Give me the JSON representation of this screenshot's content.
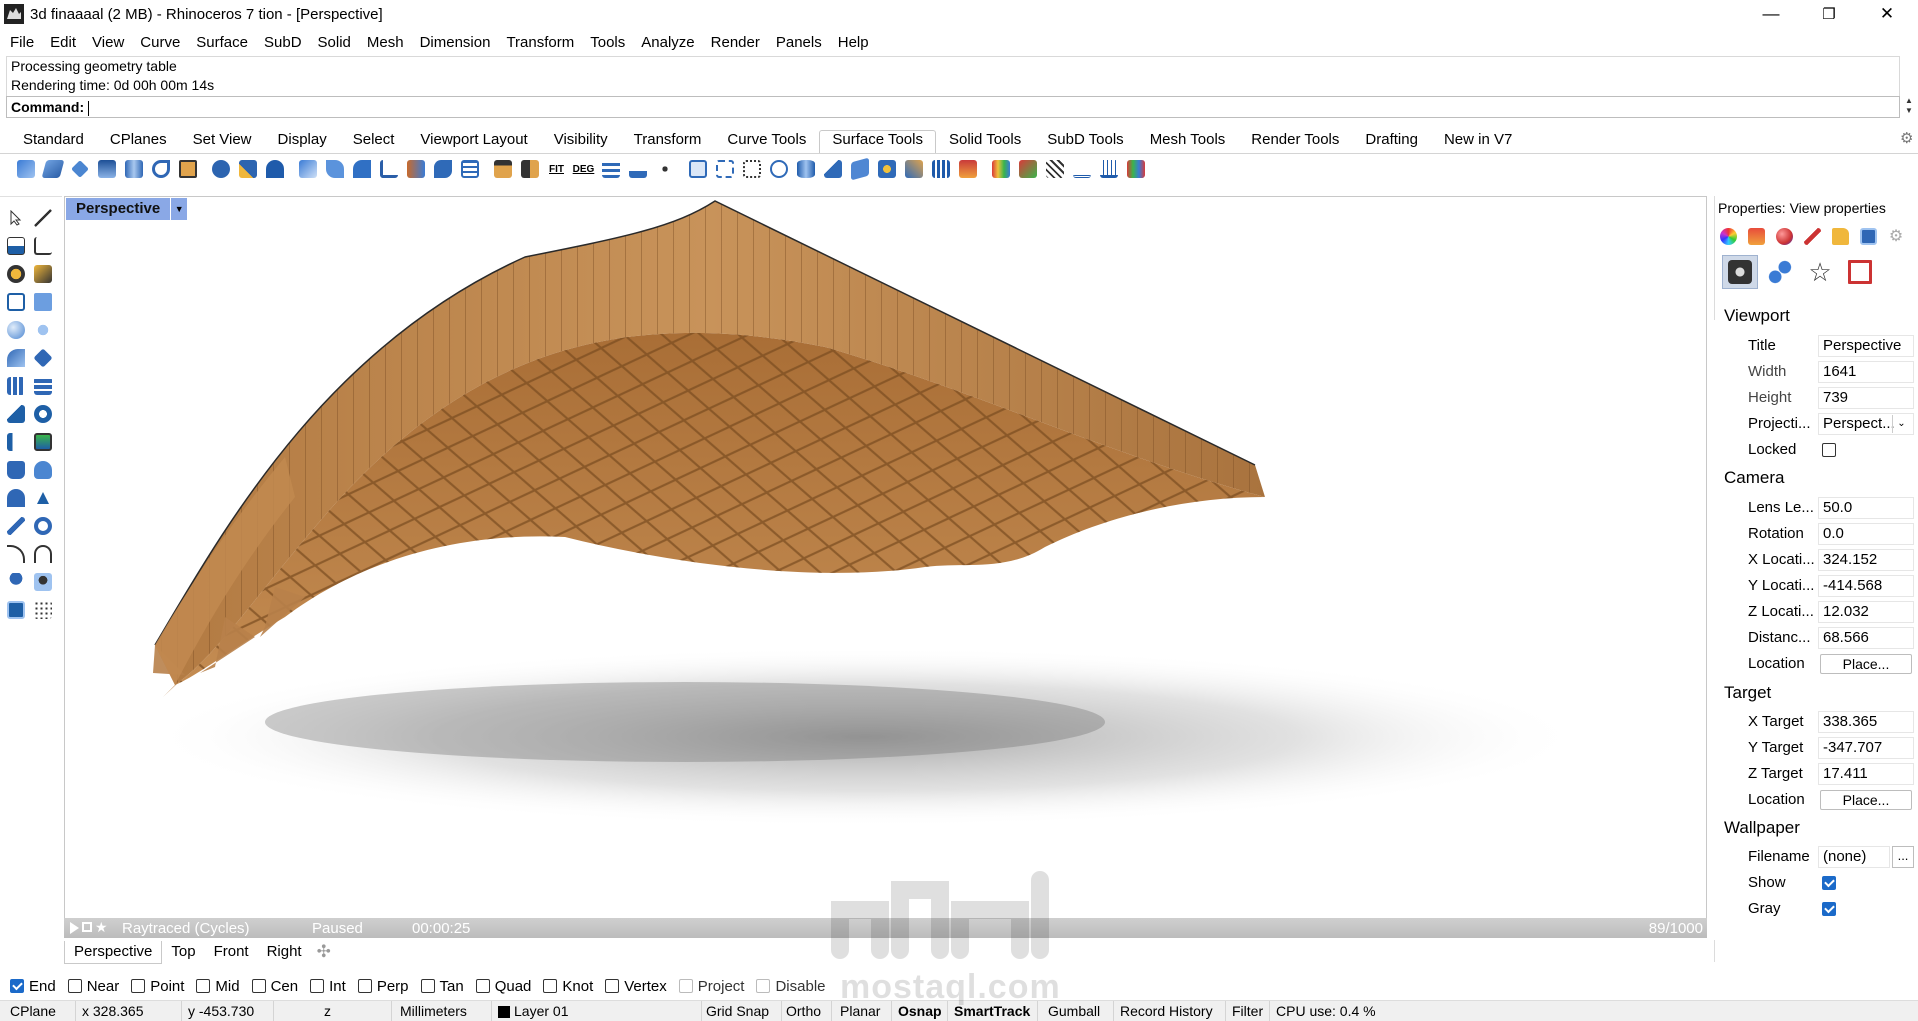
{
  "window": {
    "title": "3d finaaaal (2 MB) - Rhinoceros 7 tion - [Perspective]",
    "controls": {
      "minimize": "—",
      "restore": "❐",
      "close": "✕"
    }
  },
  "menu": [
    "File",
    "Edit",
    "View",
    "Curve",
    "Surface",
    "SubD",
    "Solid",
    "Mesh",
    "Dimension",
    "Transform",
    "Tools",
    "Analyze",
    "Render",
    "Panels",
    "Help"
  ],
  "history": [
    "Processing geometry table",
    "Rendering time: 0d 00h 00m 14s"
  ],
  "command": {
    "label": "Command:"
  },
  "toolbar_tabs": [
    "Standard",
    "CPlanes",
    "Set View",
    "Display",
    "Select",
    "Viewport Layout",
    "Visibility",
    "Transform",
    "Curve Tools",
    "Surface Tools",
    "Solid Tools",
    "SubD Tools",
    "Mesh Tools",
    "Render Tools",
    "Drafting",
    "New in V7"
  ],
  "active_toolbar_tab": "Surface Tools",
  "toolbar_icons": {
    "fit_label": "FIT",
    "deg_label": "DEG"
  },
  "viewport": {
    "title": "Perspective",
    "render": {
      "engine": "Raytraced (Cycles)",
      "state": "Paused",
      "time": "00:00:25",
      "passes": "89/1000"
    }
  },
  "viewport_tabs": [
    "Perspective",
    "Top",
    "Front",
    "Right"
  ],
  "osnaps": [
    {
      "label": "End",
      "checked": true
    },
    {
      "label": "Near",
      "checked": false
    },
    {
      "label": "Point",
      "checked": false
    },
    {
      "label": "Mid",
      "checked": false
    },
    {
      "label": "Cen",
      "checked": false
    },
    {
      "label": "Int",
      "checked": false
    },
    {
      "label": "Perp",
      "checked": false
    },
    {
      "label": "Tan",
      "checked": false
    },
    {
      "label": "Quad",
      "checked": false
    },
    {
      "label": "Knot",
      "checked": false
    },
    {
      "label": "Vertex",
      "checked": false
    },
    {
      "label": "Project",
      "checked": false
    },
    {
      "label": "Disable",
      "checked": false
    }
  ],
  "status": {
    "cplane": "CPlane",
    "x": "x 328.365",
    "y": "y -453.730",
    "z": "z",
    "units": "Millimeters",
    "layer": "Layer 01",
    "grid_snap": "Grid Snap",
    "ortho": "Ortho",
    "planar": "Planar",
    "osnap": "Osnap",
    "smarttrack": "SmartTrack",
    "gumball": "Gumball",
    "record_history": "Record History",
    "filter": "Filter",
    "cpu": "CPU use: 0.4 %"
  },
  "properties": {
    "title": "Properties: View properties",
    "sections": {
      "viewport": {
        "label": "Viewport",
        "title_label": "Title",
        "title_value": "Perspective",
        "width_label": "Width",
        "width_value": "1641",
        "height_label": "Height",
        "height_value": "739",
        "projection_label": "Projecti...",
        "projection_value": "Perspect...",
        "locked_label": "Locked",
        "locked": false
      },
      "camera": {
        "label": "Camera",
        "lens_label": "Lens Le...",
        "lens_value": "50.0",
        "rotation_label": "Rotation",
        "rotation_value": "0.0",
        "xloc_label": "X Locati...",
        "xloc_value": "324.152",
        "yloc_label": "Y Locati...",
        "yloc_value": "-414.568",
        "zloc_label": "Z Locati...",
        "zloc_value": "12.032",
        "distance_label": "Distanc...",
        "distance_value": "68.566",
        "location_label": "Location",
        "location_button": "Place..."
      },
      "target": {
        "label": "Target",
        "x_label": "X Target",
        "x_value": "338.365",
        "y_label": "Y Target",
        "y_value": "-347.707",
        "z_label": "Z Target",
        "z_value": "17.411",
        "location_label": "Location",
        "location_button": "Place..."
      },
      "wallpaper": {
        "label": "Wallpaper",
        "filename_label": "Filename",
        "filename_value": "(none)",
        "filename_button": "...",
        "show_label": "Show",
        "show": true,
        "gray_label": "Gray",
        "gray": true
      }
    }
  },
  "watermark": {
    "text": "mostaql.com"
  },
  "colors": {
    "accent": "#1b6ac9",
    "viewport_title_bg": "#8aa8e6",
    "wood": "#b98449"
  }
}
